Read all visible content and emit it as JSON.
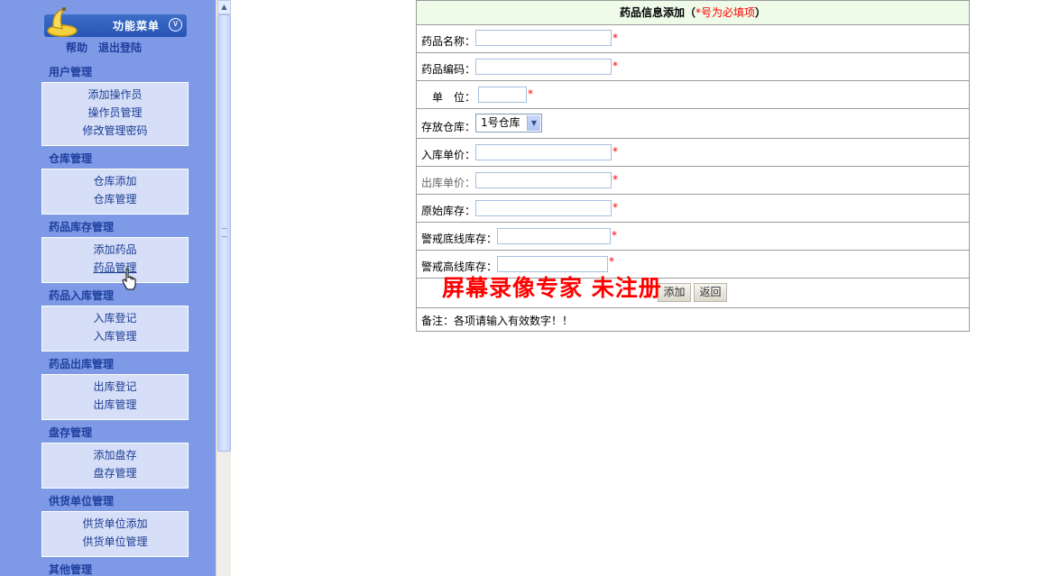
{
  "sidebar": {
    "menu_title": "功能菜单",
    "help_link": "帮助",
    "logout_link": "退出登陆",
    "sections": [
      {
        "title": "用户管理",
        "items": [
          "添加操作员",
          "操作员管理",
          "修改管理密码"
        ]
      },
      {
        "title": "仓库管理",
        "items": [
          "仓库添加",
          "仓库管理"
        ]
      },
      {
        "title": "药品库存管理",
        "items": [
          "添加药品",
          "药品管理"
        ]
      },
      {
        "title": "药品入库管理",
        "items": [
          "入库登记",
          "入库管理"
        ]
      },
      {
        "title": "药品出库管理",
        "items": [
          "出库登记",
          "出库管理"
        ]
      },
      {
        "title": "盘存管理",
        "items": [
          "添加盘存",
          "盘存管理"
        ]
      },
      {
        "title": "供货单位管理",
        "items": [
          "供货单位添加",
          "供货单位管理"
        ]
      },
      {
        "title": "其他管理",
        "items": []
      }
    ]
  },
  "form": {
    "title": "药品信息添加（",
    "required_note": "*号为必填项",
    "title_close": "）",
    "star": "*",
    "fields": {
      "name_label": "药品名称：",
      "name_value": "",
      "code_label": "药品编码：",
      "code_value": "",
      "unit_label": "单　位：",
      "unit_value": "",
      "warehouse_label": "存放仓库：",
      "warehouse_value": "1号仓库",
      "in_price_label": "入库单价：",
      "in_price_value": "",
      "out_price_label": "出库单价：",
      "out_price_value": "",
      "stock_label": "原始库存：",
      "stock_value": "",
      "low_label": "警戒底线库存：",
      "low_value": "",
      "high_label": "警戒高线库存：",
      "high_value": ""
    },
    "add_button": "添加",
    "back_button": "返回",
    "note": "备注：各项请输入有效数字！！"
  },
  "watermark": "屏幕录像专家  未注册",
  "colors": {
    "sidebar_bg": "#7e9ae6",
    "section_box_bg": "#d6dff7",
    "link_color": "#1e3f9e",
    "required_color": "#ff0000",
    "form_header_bg": "#eefbe9"
  }
}
